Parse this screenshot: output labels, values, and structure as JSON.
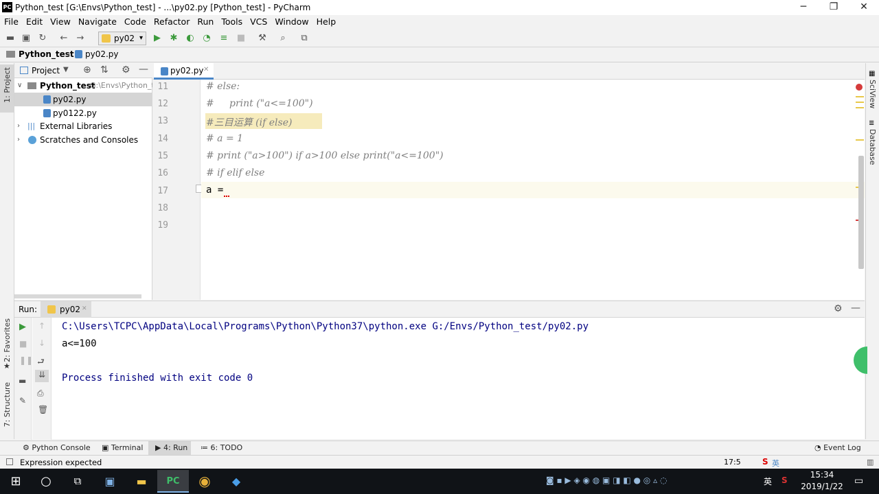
{
  "window": {
    "title": "Python_test [G:\\Envs\\Python_test] - ...\\py02.py [Python_test] - PyCharm",
    "app_icon_text": "PC",
    "minimize": "─",
    "maximize": "❐",
    "close": "✕"
  },
  "menu": [
    "File",
    "Edit",
    "View",
    "Navigate",
    "Code",
    "Refactor",
    "Run",
    "Tools",
    "VCS",
    "Window",
    "Help"
  ],
  "toolbar": {
    "run_config": "py02"
  },
  "breadcrumb": {
    "project": "Python_test",
    "file": "py02.py"
  },
  "left_strip": {
    "project_tab": "1: Project",
    "favorites_tab": "2: Favorites",
    "structure_tab": "7: Structure"
  },
  "project_panel": {
    "header": "Project",
    "root_name": "Python_test",
    "root_path": "G:\\Envs\\Python_t",
    "files": [
      "py02.py",
      "py0122.py"
    ],
    "external": "External Libraries",
    "scratches": "Scratches and Consoles"
  },
  "editor": {
    "tab": "py02.py",
    "lines": [
      {
        "n": "11",
        "text": "# else:"
      },
      {
        "n": "12",
        "text": "#     print (\"a<=100\")"
      },
      {
        "n": "13",
        "text": "#三目运算 (if else)"
      },
      {
        "n": "14",
        "text": "# a = 1"
      },
      {
        "n": "15",
        "text": "# print (\"a>100\") if a>100 else print(\"a<=100\")"
      },
      {
        "n": "16",
        "text": "# if elif else"
      },
      {
        "n": "17",
        "text": "a = "
      },
      {
        "n": "18",
        "text": ""
      },
      {
        "n": "19",
        "text": ""
      }
    ]
  },
  "right_strip": {
    "sciview": "SciView",
    "database": "Database"
  },
  "run_panel": {
    "label": "Run:",
    "tab": "py02",
    "output": [
      "C:\\Users\\TCPC\\AppData\\Local\\Programs\\Python\\Python37\\python.exe G:/Envs/Python_test/py02.py",
      "a<=100",
      "",
      "Process finished with exit code 0"
    ]
  },
  "bottom_tabs": {
    "python_console": "Python Console",
    "terminal": "Terminal",
    "run": "4: Run",
    "todo": "6: TODO",
    "event_log": "Event Log"
  },
  "status": {
    "message": "Expression expected",
    "position": "17:5"
  },
  "taskbar": {
    "time": "15:34",
    "date": "2019/1/22",
    "ime": "英"
  },
  "colors": {
    "accent_green": "#3c9a3c",
    "selection": "#d5d5d5",
    "caret_line": "#fcfaed",
    "highlight": "#f6ebbc"
  }
}
